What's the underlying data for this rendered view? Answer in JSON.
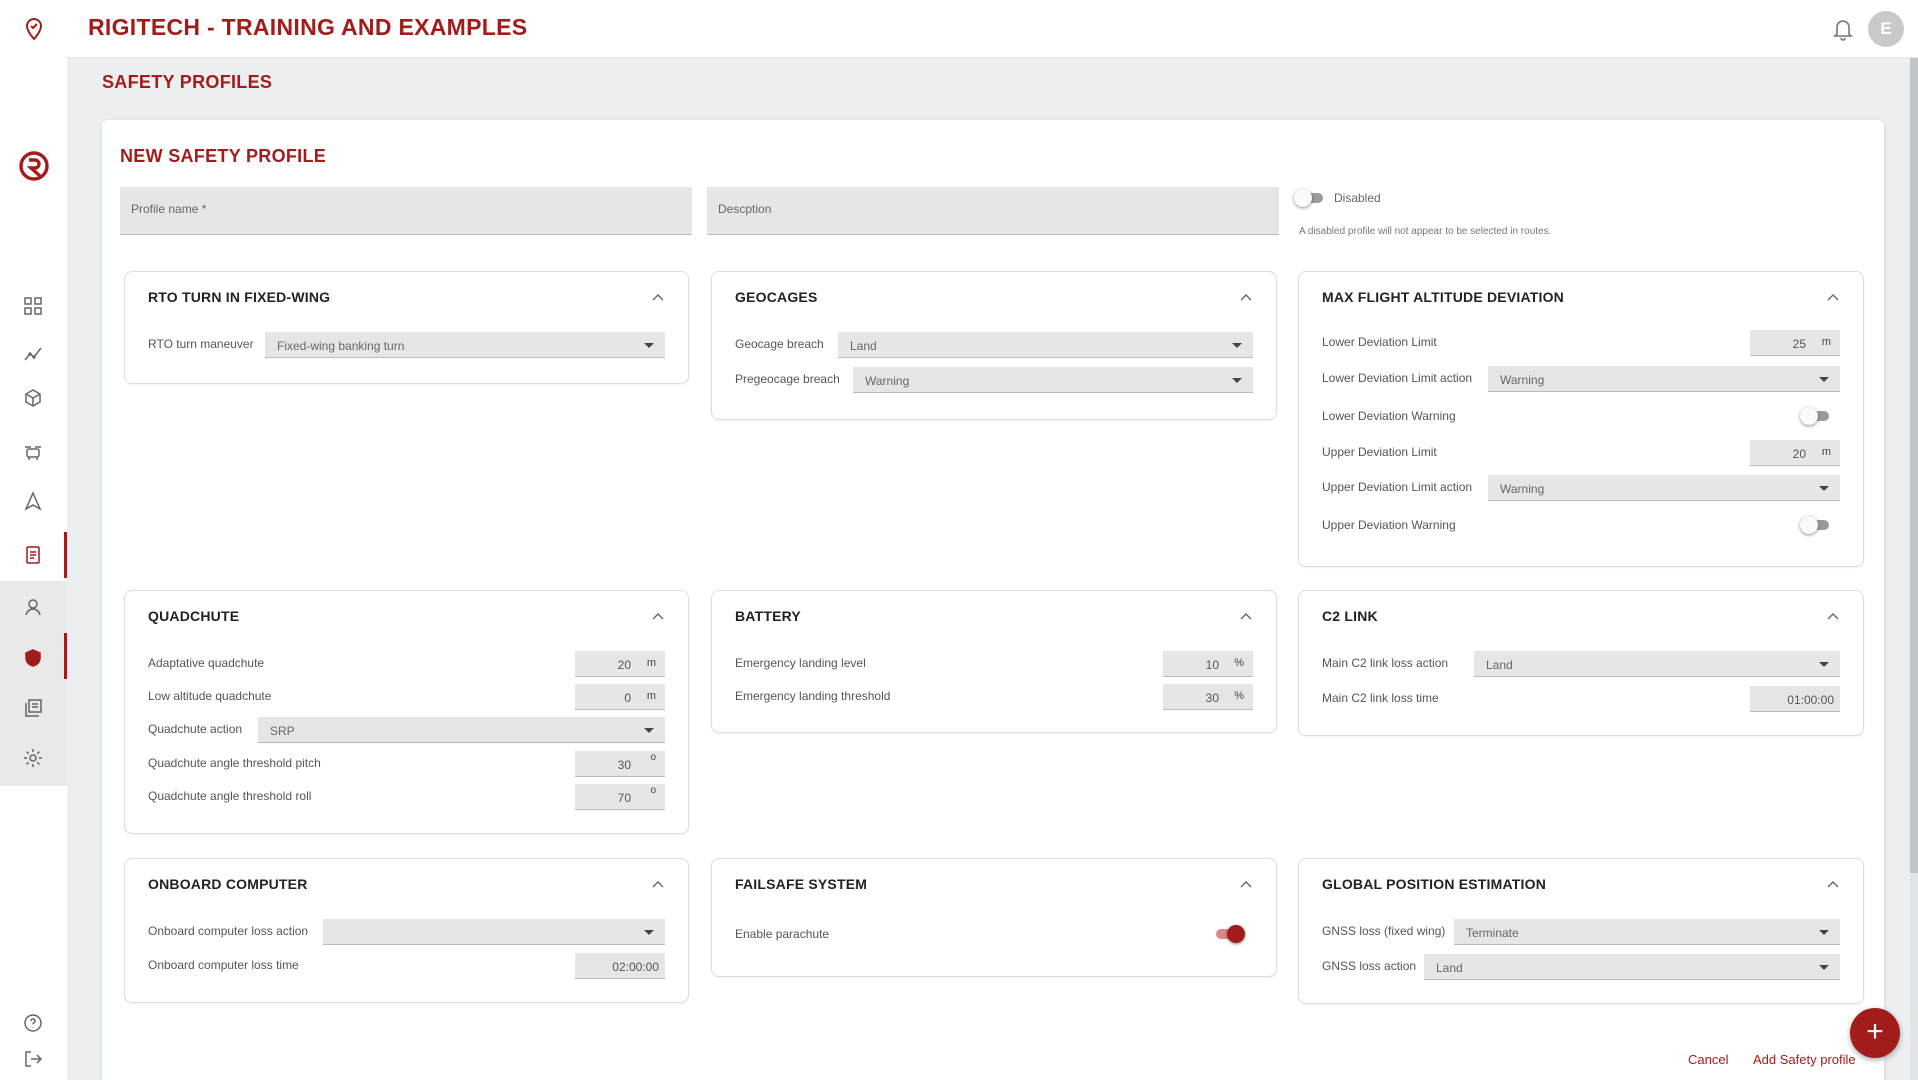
{
  "app": {
    "title": "RIGITECH - TRAINING AND EXAMPLES",
    "user_initial": "E"
  },
  "page": {
    "title": "SAFETY PROFILES"
  },
  "form": {
    "title": "NEW SAFETY PROFILE",
    "profile_name_placeholder": "Profile name *",
    "description_placeholder": "Descption",
    "status_label": "Disabled",
    "status_enabled": false,
    "hint": "A disabled profile will not appear to be selected in routes."
  },
  "panels": {
    "rto": {
      "title": "RTO TURN IN FIXED-WING",
      "maneuver_label": "RTO turn maneuver",
      "maneuver_value": "Fixed-wing banking turn"
    },
    "geocages": {
      "title": "GEOCAGES",
      "breach_label": "Geocage breach",
      "breach_value": "Land",
      "prebreach_label": "Pregeocage breach",
      "prebreach_value": "Warning"
    },
    "altitude": {
      "title": "MAX FLIGHT ALTITUDE DEVIATION",
      "lower_limit_label": "Lower Deviation Limit",
      "lower_limit_value": "25",
      "lower_limit_unit": "m",
      "lower_action_label": "Lower Deviation Limit action",
      "lower_action_value": "Warning",
      "lower_warning_label": "Lower Deviation Warning",
      "lower_warning_on": false,
      "upper_limit_label": "Upper Deviation Limit",
      "upper_limit_value": "20",
      "upper_limit_unit": "m",
      "upper_action_label": "Upper Deviation Limit action",
      "upper_action_value": "Warning",
      "upper_warning_label": "Upper Deviation Warning",
      "upper_warning_on": false
    },
    "quadchute": {
      "title": "QUADCHUTE",
      "adaptative_label": "Adaptative quadchute",
      "adaptative_value": "20",
      "adaptative_unit": "m",
      "low_alt_label": "Low altitude quadchute",
      "low_alt_value": "0",
      "low_alt_unit": "m",
      "action_label": "Quadchute action",
      "action_value": "SRP",
      "pitch_label": "Quadchute angle threshold pitch",
      "pitch_value": "30",
      "pitch_unit": "o",
      "roll_label": "Quadchute angle threshold roll",
      "roll_value": "70",
      "roll_unit": "o"
    },
    "battery": {
      "title": "BATTERY",
      "level_label": "Emergency landing level",
      "level_value": "10",
      "level_unit": "%",
      "threshold_label": "Emergency landing threshold",
      "threshold_value": "30",
      "threshold_unit": "%"
    },
    "c2link": {
      "title": "C2 LINK",
      "action_label": "Main C2 link loss action",
      "action_value": "Land",
      "time_label": "Main C2 link loss time",
      "time_value": "01:00:00"
    },
    "onboard": {
      "title": "ONBOARD COMPUTER",
      "action_label": "Onboard computer loss action",
      "action_value": "",
      "time_label": "Onboard computer loss time",
      "time_value": "02:00:00"
    },
    "failsafe": {
      "title": "FAILSAFE SYSTEM",
      "parachute_label": "Enable parachute",
      "parachute_on": true
    },
    "gps": {
      "title": "GLOBAL POSITION ESTIMATION",
      "gnss_fw_label": "GNSS loss (fixed wing)",
      "gnss_fw_value": "Terminate",
      "gnss_action_label": "GNSS loss action",
      "gnss_action_value": "Land"
    }
  },
  "footer": {
    "cancel_label": "Cancel",
    "add_label": "Add Safety profile",
    "fab_label": "+"
  },
  "colors": {
    "brand": "#a31c1c",
    "field_bg": "#e6e6e6"
  },
  "icons": [
    "location-pin-icon",
    "brand-logo-icon",
    "dashboard-icon",
    "analytics-icon",
    "cube-icon",
    "drone-icon",
    "navigation-icon",
    "document-icon",
    "user-icon",
    "shield-icon",
    "library-icon",
    "gear-icon",
    "help-icon",
    "logout-icon",
    "bell-icon",
    "chevron-up-icon"
  ]
}
